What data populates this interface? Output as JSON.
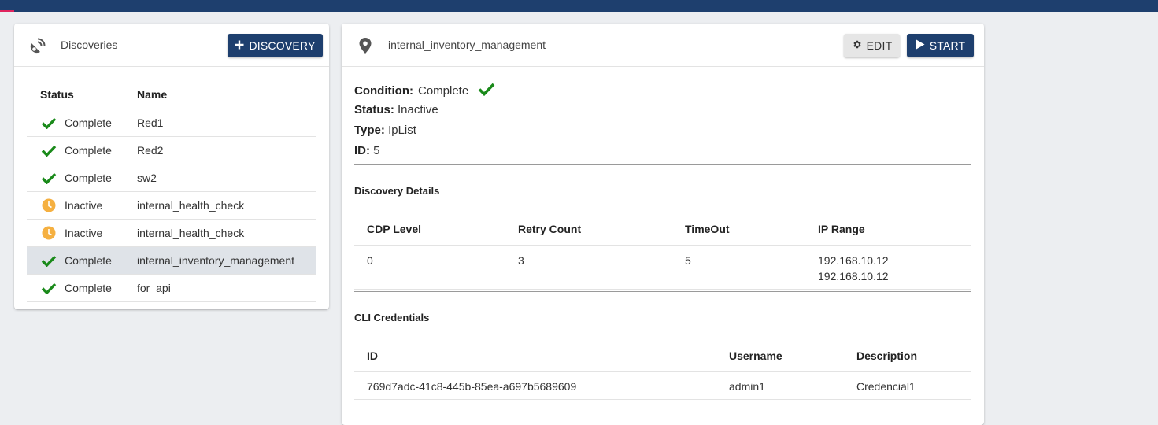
{
  "colors": {
    "brand": "#1e3f6e",
    "success": "#1a8a1a",
    "warning": "#f5b041"
  },
  "discoveries_panel": {
    "title": "Discoveries",
    "icon": "satellite-dish-icon",
    "add_button": {
      "icon": "plus-icon",
      "label": "DISCOVERY"
    },
    "columns": [
      "Status",
      "Name"
    ],
    "rows": [
      {
        "status": "Complete",
        "status_icon": "check-icon",
        "name": "Red1"
      },
      {
        "status": "Complete",
        "status_icon": "check-icon",
        "name": "Red2"
      },
      {
        "status": "Complete",
        "status_icon": "check-icon",
        "name": "sw2"
      },
      {
        "status": "Inactive",
        "status_icon": "clock-icon",
        "name": "internal_health_check"
      },
      {
        "status": "Inactive",
        "status_icon": "clock-icon",
        "name": "internal_health_check"
      },
      {
        "status": "Complete",
        "status_icon": "check-icon",
        "name": "internal_inventory_management",
        "selected": true
      },
      {
        "status": "Complete",
        "status_icon": "check-icon",
        "name": "for_api"
      }
    ]
  },
  "detail_panel": {
    "title": "internal_inventory_management",
    "icon": "map-marker-icon",
    "edit_button": {
      "icon": "gear-icon",
      "label": "EDIT"
    },
    "start_button": {
      "icon": "play-icon",
      "label": "START"
    },
    "condition_label": "Condition:",
    "condition_value": "Complete",
    "status_label": "Status:",
    "status_value": "Inactive",
    "type_label": "Type:",
    "type_value": "IpList",
    "id_label": "ID:",
    "id_value": "5",
    "discovery_details": {
      "title": "Discovery Details",
      "columns": [
        "CDP Level",
        "Retry Count",
        "TimeOut",
        "IP Range"
      ],
      "row": {
        "cdp_level": "0",
        "retry_count": "3",
        "timeout": "5",
        "ip_range": [
          "192.168.10.12",
          "192.168.10.12"
        ]
      }
    },
    "cli_credentials": {
      "title": "CLI Credentials",
      "columns": [
        "ID",
        "Username",
        "Description"
      ],
      "row": {
        "id": "769d7adc-41c8-445b-85ea-a697b5689609",
        "username": "admin1",
        "description": "Credencial1"
      }
    }
  }
}
